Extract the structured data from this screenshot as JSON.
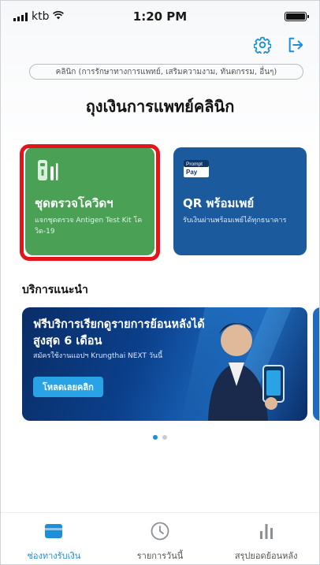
{
  "status_bar": {
    "carrier": "ktb",
    "time": "1:20 PM"
  },
  "header": {
    "category_text": "คลินิก (การรักษาทางการแพทย์, เสริมความงาม, ทันตกรรม, อื่นๆ)",
    "title": "ถุงเงินการแพทย์คลินิก"
  },
  "cards": [
    {
      "title": "ชุดตรวจโควิดฯ",
      "desc": "แจกชุดตรวจ Antigen Test Kit โควิด-19",
      "color": "#4aa055",
      "icon": "test-kit-icon"
    },
    {
      "title": "QR พร้อมเพย์",
      "desc": "รับเงินผ่านพร้อมเพย์ได้ทุกธนาคาร",
      "color": "#1b5a9c",
      "icon": "promptpay-icon",
      "icon_text_top": "Prompt",
      "icon_text_bottom": "Pay"
    }
  ],
  "highlight_color": "#e5141b",
  "section": {
    "title": "บริการแนะนำ"
  },
  "banner": {
    "title": "ฟรีบริการเรียกดูรายการย้อนหลังได้สูงสุด 6 เดือน",
    "subtitle": "สมัครใช้งานแอปฯ Krungthai NEXT วันนี้",
    "cta": "โหลดเลยคลิก"
  },
  "carousel": {
    "pages": 2,
    "active": 1
  },
  "bottom_nav": [
    {
      "label": "ช่องทางรับเงิน",
      "icon": "wallet-icon",
      "active": true
    },
    {
      "label": "รายการวันนี้",
      "icon": "clock-icon",
      "active": false
    },
    {
      "label": "สรุปยอดย้อนหลัง",
      "icon": "bar-chart-icon",
      "active": false
    }
  ],
  "colors": {
    "accent": "#1e8fd6",
    "inactive": "#8a8f96"
  }
}
